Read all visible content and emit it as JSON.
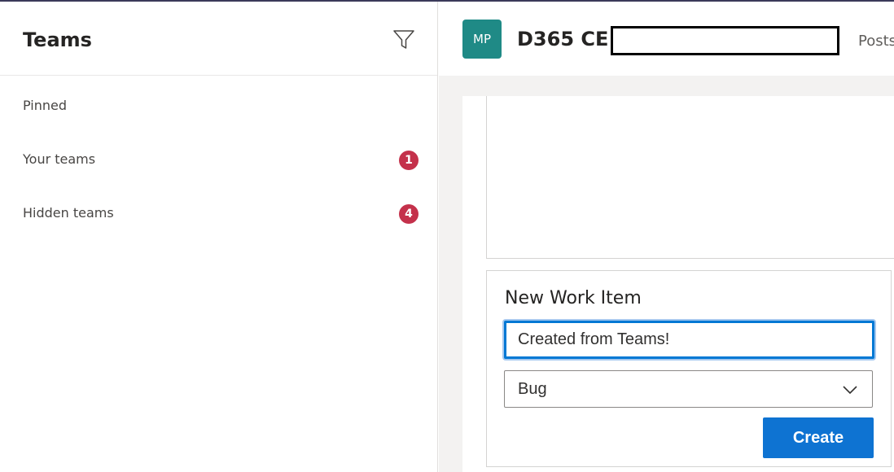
{
  "left_panel": {
    "title": "Teams",
    "filter_icon": "filter-icon",
    "items": [
      {
        "label": "Pinned",
        "badge": null
      },
      {
        "label": "Your teams",
        "badge": "1"
      },
      {
        "label": "Hidden teams",
        "badge": "4"
      }
    ]
  },
  "header": {
    "avatar_initials": "MP",
    "channel_title": "D365 CE I",
    "tab_posts": "Posts"
  },
  "form": {
    "title": "New Work Item",
    "title_input_value": "Created from Teams!",
    "type_select_value": "Bug",
    "create_label": "Create"
  },
  "colors": {
    "accent": "#0e73d2",
    "badge": "#c4314b",
    "avatar": "#1f8a86"
  }
}
